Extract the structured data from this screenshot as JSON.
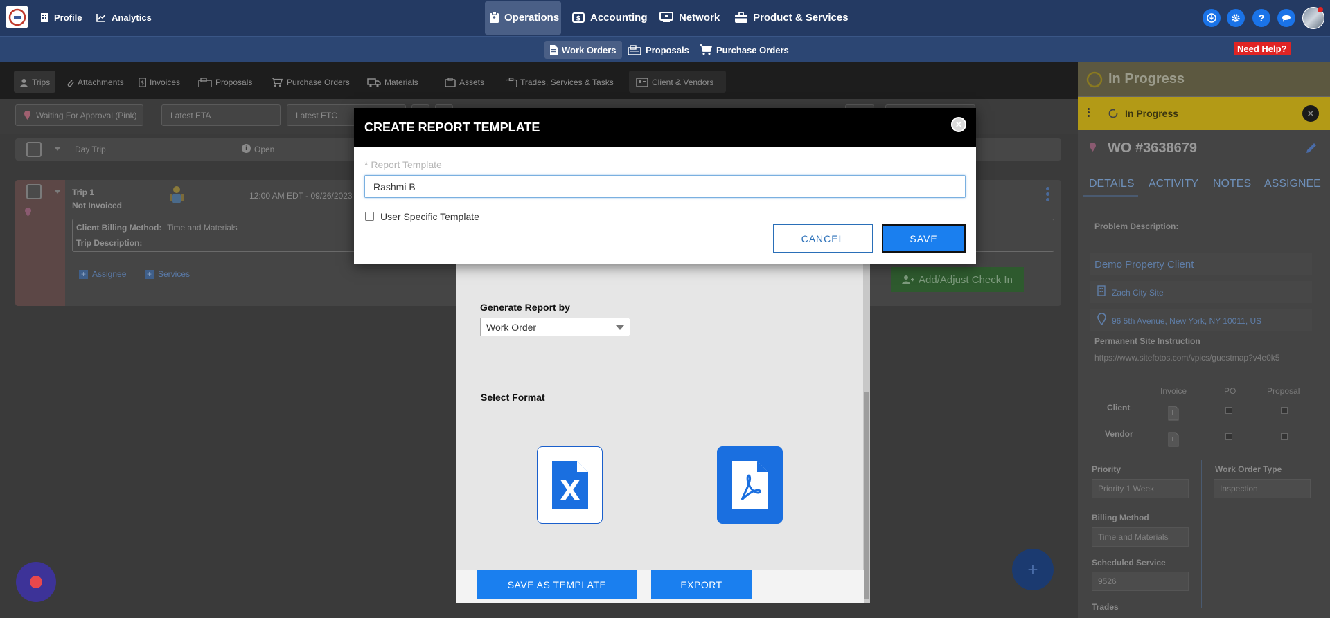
{
  "topnav": {
    "left": [
      {
        "label": "Profile"
      },
      {
        "label": "Analytics"
      }
    ],
    "center": [
      {
        "label": "Operations"
      },
      {
        "label": "Accounting"
      },
      {
        "label": "Network"
      },
      {
        "label": "Product & Services"
      }
    ],
    "help_badge": "Need Help?"
  },
  "subnav": {
    "items": [
      {
        "label": "Work Orders"
      },
      {
        "label": "Proposals"
      },
      {
        "label": "Purchase Orders"
      }
    ]
  },
  "tabs": [
    "Trips",
    "Attachments",
    "Invoices",
    "Proposals",
    "Purchase Orders",
    "Materials",
    "Assets",
    "Trades, Services & Tasks",
    "Client & Vendors"
  ],
  "filters": {
    "status": "Waiting For Approval (Pink)",
    "eta_placeholder": "Latest ETA",
    "etc_placeholder": "Latest ETC"
  },
  "trip": {
    "day_trip": "Day Trip",
    "open": "Open",
    "title": "Trip 1",
    "invoice_status": "Not Invoiced",
    "time": "12:00 AM EDT - 09/26/2023",
    "billing_label": "Client Billing Method:",
    "billing_value": "Time and Materials",
    "desc_label": "Trip Description:",
    "assignee": "Assignee",
    "services": "Services",
    "check_in": "Add/Adjust Check In"
  },
  "right_panel": {
    "status_header": "In Progress",
    "status_bar": "In Progress",
    "wo_number": "WO #3638679",
    "tabs": [
      "DETAILS",
      "ACTIVITY",
      "NOTES",
      "ASSIGNEE"
    ],
    "problem_label": "Problem Description:",
    "client": "Demo Property Client",
    "site": "Zach City Site",
    "address": "96 5th Avenue, New York, NY 10011, US",
    "psi_label": "Permanent Site Instruction",
    "psi_url": "https://www.sitefotos.com/vpics/guestmap?v4e0k5",
    "cols": [
      "Invoice",
      "PO",
      "Proposal"
    ],
    "rows": [
      "Client",
      "Vendor"
    ],
    "priority_label": "Priority",
    "priority_value": "Priority 1 Week",
    "wo_type_label": "Work Order Type",
    "wo_type_value": "Inspection",
    "billing_label": "Billing Method",
    "billing_value": "Time and Materials",
    "scheduled_label": "Scheduled Service",
    "scheduled_value": "9526",
    "trades_label": "Trades"
  },
  "report_modal": {
    "generate_label": "Generate Report by",
    "generate_value": "Work Order",
    "format_label": "Select Format",
    "save_template": "SAVE AS TEMPLATE",
    "export": "EXPORT"
  },
  "dialog": {
    "title": "CREATE REPORT TEMPLATE",
    "field_label": "* Report Template",
    "field_value": "Rashmi B",
    "checkbox_label": "User Specific Template",
    "cancel": "CANCEL",
    "save": "SAVE"
  },
  "colors": {
    "nav": "#243a63",
    "accent": "#1a7fef",
    "status": "#f4d000",
    "help": "#e02424"
  }
}
